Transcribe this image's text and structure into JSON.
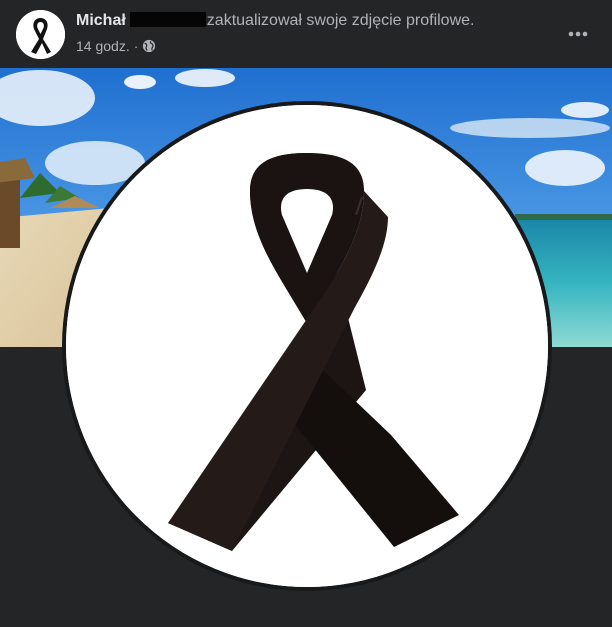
{
  "post": {
    "author_name": "Michał",
    "action_text": "zaktualizował swoje zdjęcie profilowe.",
    "timestamp": "14 godz.",
    "separator": "·",
    "audience_icon": "globe-icon",
    "more_icon": "more-options-icon"
  },
  "avatar": {
    "icon": "black-ribbon-icon"
  },
  "cover_photo": {
    "description_icon": "beach-scene"
  },
  "profile_photo": {
    "icon": "black-mourning-ribbon"
  },
  "colors": {
    "background": "#242526",
    "primary_text": "#e4e6eb",
    "secondary_text": "#b0b3b8",
    "ribbon": "#1a1412"
  }
}
